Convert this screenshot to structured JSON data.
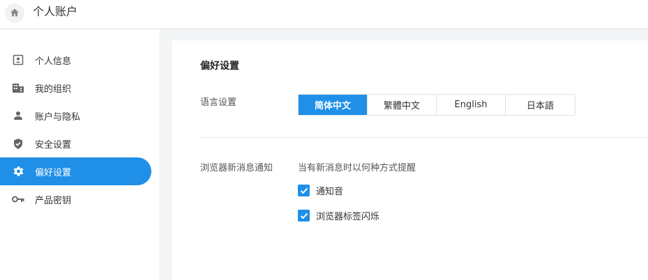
{
  "header": {
    "home_icon": "home-icon",
    "title": "个人账户"
  },
  "sidebar": {
    "items": [
      {
        "label": "个人信息",
        "icon": "id-card-icon",
        "active": false
      },
      {
        "label": "我的组织",
        "icon": "building-icon",
        "active": false
      },
      {
        "label": "账户与隐私",
        "icon": "person-icon",
        "active": false
      },
      {
        "label": "安全设置",
        "icon": "shield-check-icon",
        "active": false
      },
      {
        "label": "偏好设置",
        "icon": "gear-icon",
        "active": true
      },
      {
        "label": "产品密钥",
        "icon": "key-icon",
        "active": false
      }
    ]
  },
  "main": {
    "title": "偏好设置",
    "language": {
      "label": "语言设置",
      "options": [
        "简体中文",
        "繁體中文",
        "English",
        "日本語"
      ],
      "selected": "简体中文"
    },
    "notifications": {
      "label": "浏览器新消息通知",
      "hint": "当有新消息时以何种方式提醒",
      "options": [
        {
          "label": "通知音",
          "checked": true
        },
        {
          "label": "浏览器标签闪烁",
          "checked": true
        }
      ]
    }
  },
  "colors": {
    "accent": "#1f8fe8",
    "content_background": "#f4f5f7",
    "text": "#333333"
  }
}
